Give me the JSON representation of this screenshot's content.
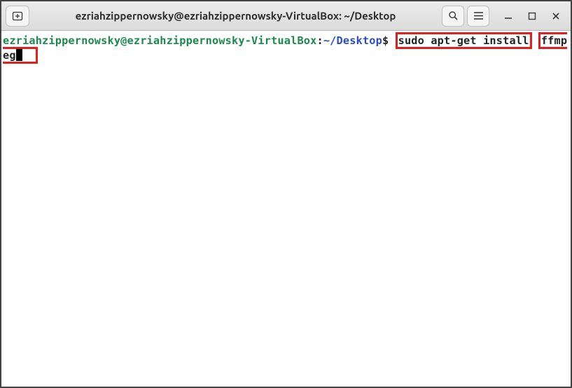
{
  "titlebar": {
    "title": "ezriahzippernowsky@ezriahzippernowsky-VirtualBox: ~/Desktop",
    "new_tab_label": "New Tab",
    "search_label": "Search",
    "menu_label": "Menu",
    "minimize_label": "Minimize",
    "maximize_label": "Maximize",
    "close_label": "Close"
  },
  "terminal": {
    "prompt": {
      "user_host": "ezriahzippernowsky@ezriahzippernowsky-VirtualBox",
      "separator": ":",
      "path": "~/Desktop",
      "symbol": "$"
    },
    "command_part1": "sudo apt-get install",
    "command_part2": "ffmpeg"
  },
  "colors": {
    "user_host": "#1a8a4c",
    "path": "#2a4cc0",
    "highlight_border": "#e02020",
    "titlebar_bg": "#e3e3e3"
  }
}
